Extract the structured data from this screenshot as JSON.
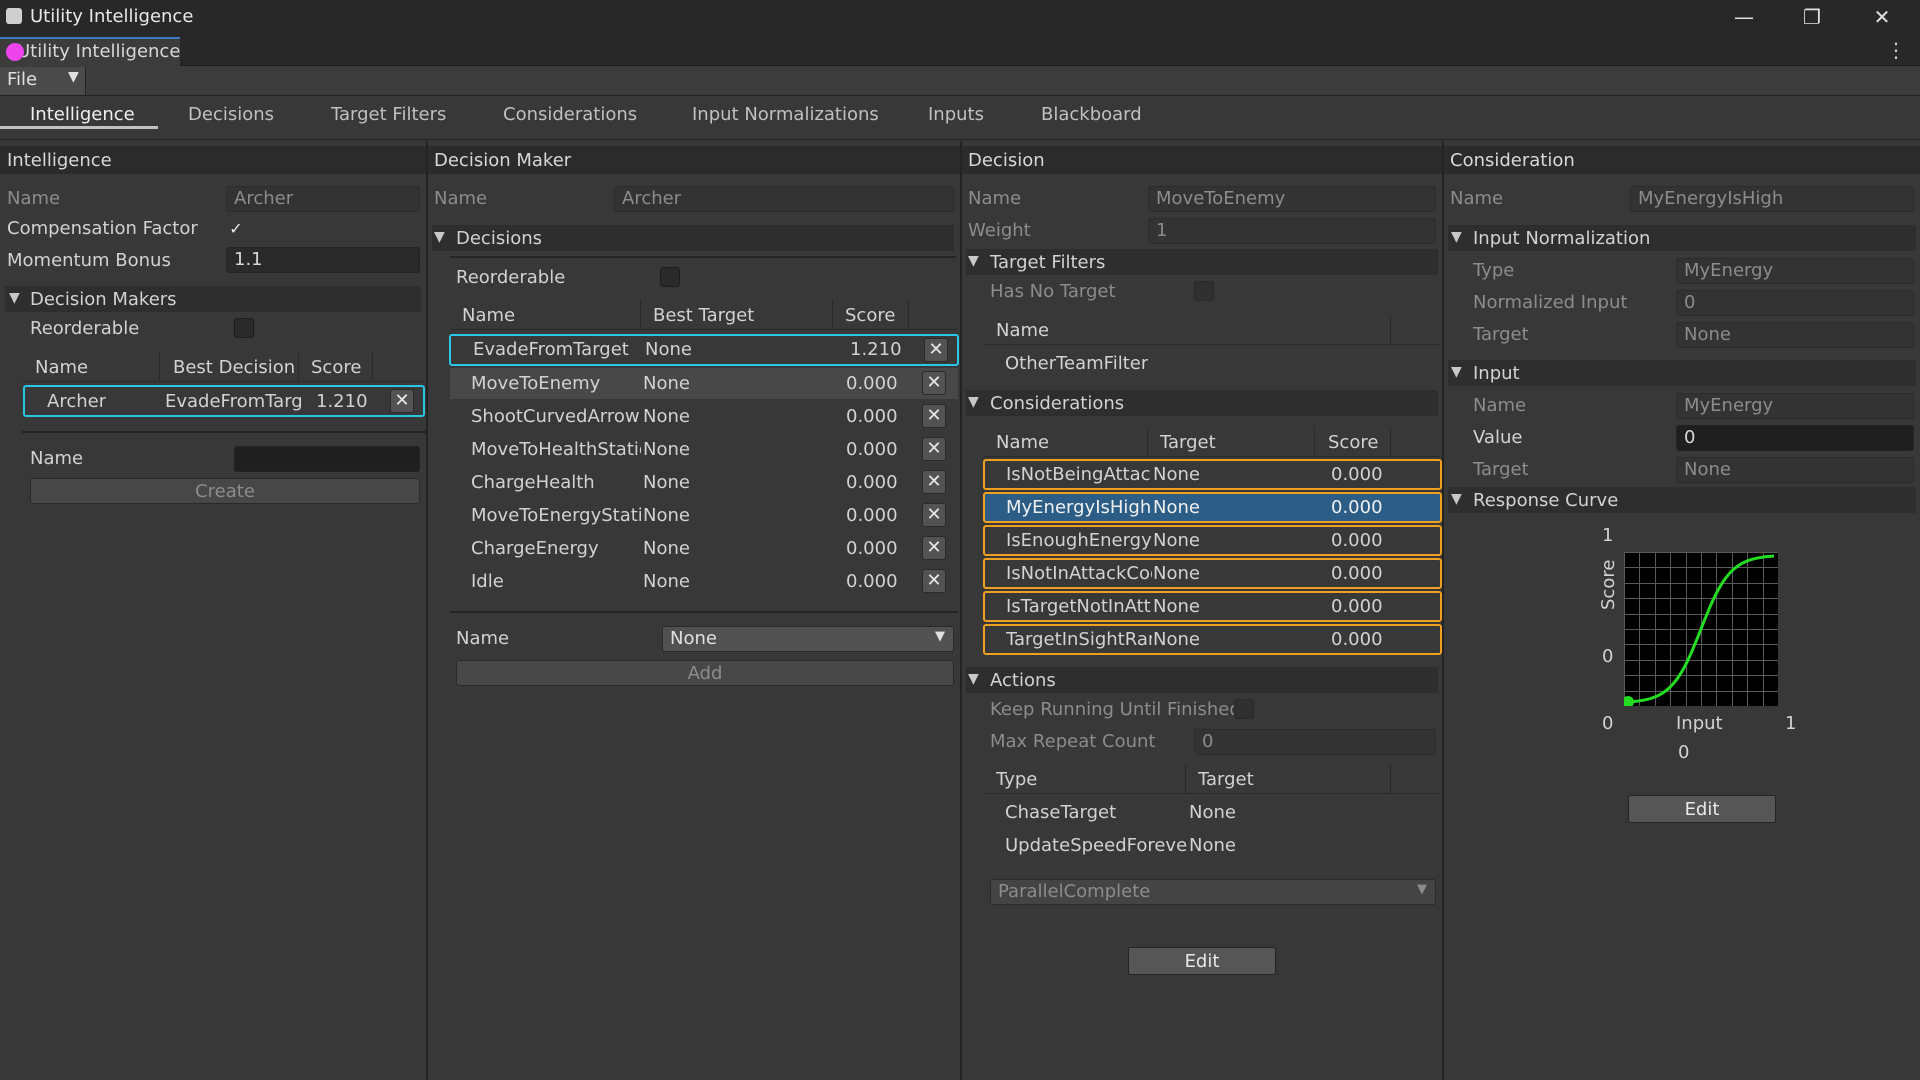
{
  "window": {
    "title": "Utility Intelligence",
    "tab_label": "Utility Intelligence"
  },
  "menu": {
    "file": "File"
  },
  "tabs": [
    "Intelligence",
    "Decisions",
    "Target Filters",
    "Considerations",
    "Input Normalizations",
    "Inputs",
    "Blackboard"
  ],
  "intelligence": {
    "title": "Intelligence",
    "name_label": "Name",
    "name_value": "Archer",
    "compensation_label": "Compensation Factor",
    "momentum_label": "Momentum Bonus",
    "momentum_value": "1.1",
    "decision_makers_label": "Decision Makers",
    "reorderable_label": "Reorderable",
    "columns": [
      "Name",
      "Best Decision",
      "Score"
    ],
    "rows": [
      {
        "name": "Archer",
        "best": "EvadeFromTarget",
        "score": "1.210"
      }
    ],
    "new_name_label": "Name",
    "create_label": "Create"
  },
  "decision_maker": {
    "title": "Decision Maker",
    "name_label": "Name",
    "name_value": "Archer",
    "decisions_label": "Decisions",
    "reorderable_label": "Reorderable",
    "columns": [
      "Name",
      "Best Target",
      "Score"
    ],
    "rows": [
      {
        "name": "EvadeFromTarget",
        "target": "None",
        "score": "1.210"
      },
      {
        "name": "MoveToEnemy",
        "target": "None",
        "score": "0.000"
      },
      {
        "name": "ShootCurvedArrow",
        "target": "None",
        "score": "0.000"
      },
      {
        "name": "MoveToHealthStation",
        "target": "None",
        "score": "0.000"
      },
      {
        "name": "ChargeHealth",
        "target": "None",
        "score": "0.000"
      },
      {
        "name": "MoveToEnergyStation",
        "target": "None",
        "score": "0.000"
      },
      {
        "name": "ChargeEnergy",
        "target": "None",
        "score": "0.000"
      },
      {
        "name": "Idle",
        "target": "None",
        "score": "0.000"
      }
    ],
    "add_name_label": "Name",
    "add_dropdown_value": "None",
    "add_label": "Add"
  },
  "decision": {
    "title": "Decision",
    "name_label": "Name",
    "name_value": "MoveToEnemy",
    "weight_label": "Weight",
    "weight_value": "1",
    "target_filters_label": "Target Filters",
    "has_no_target_label": "Has No Target",
    "filter_columns": [
      "Name"
    ],
    "filter_rows": [
      "OtherTeamFilter"
    ],
    "considerations_label": "Considerations",
    "consideration_columns": [
      "Name",
      "Target",
      "Score"
    ],
    "consideration_rows": [
      {
        "name": "IsNotBeingAttacked",
        "target": "None",
        "score": "0.000"
      },
      {
        "name": "MyEnergyIsHigh",
        "target": "None",
        "score": "0.000"
      },
      {
        "name": "IsEnoughEnergy",
        "target": "None",
        "score": "0.000"
      },
      {
        "name": "IsNotInAttackCooldown",
        "target": "None",
        "score": "0.000"
      },
      {
        "name": "IsTargetNotInAttackRange",
        "target": "None",
        "score": "0.000"
      },
      {
        "name": "TargetInSightRange",
        "target": "None",
        "score": "0.000"
      }
    ],
    "actions_label": "Actions",
    "keep_running_label": "Keep Running Until Finished",
    "max_repeat_label": "Max Repeat Count",
    "max_repeat_value": "0",
    "action_columns": [
      "Type",
      "Target"
    ],
    "action_rows": [
      {
        "type": "ChaseTarget",
        "target": "None"
      },
      {
        "type": "UpdateSpeedForever",
        "target": "None"
      }
    ],
    "execution_mode": "ParallelComplete",
    "edit_label": "Edit"
  },
  "consideration": {
    "title": "Consideration",
    "name_label": "Name",
    "name_value": "MyEnergyIsHigh",
    "input_normalization_label": "Input Normalization",
    "type_label": "Type",
    "type_value": "MyEnergy",
    "normalized_input_label": "Normalized Input",
    "normalized_input_value": "0",
    "target_label": "Target",
    "target_value": "None",
    "input_label": "Input",
    "input_name_label": "Name",
    "input_name_value": "MyEnergy",
    "value_label": "Value",
    "value_value": "0",
    "input_target_label": "Target",
    "input_target_value": "None",
    "response_curve_label": "Response Curve",
    "curve": {
      "y_max_label": "1",
      "y_min_label": "0",
      "y_axis_label": "Score",
      "x_min_label": "0",
      "x_max_label": "1",
      "x_axis_label": "Input",
      "current_input": "0",
      "line_color": "#22dd22"
    },
    "edit_label": "Edit"
  },
  "colors": {
    "selected_outline": "#2ac6e6",
    "consideration_outline": "#f0a020",
    "selected_fill": "#2c5d87"
  }
}
